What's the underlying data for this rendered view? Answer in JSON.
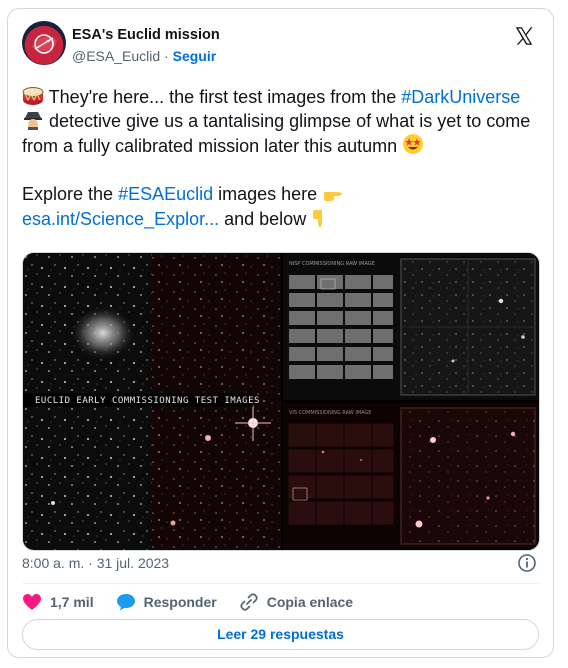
{
  "author": {
    "name": "ESA's Euclid mission",
    "handle": "@ESA_Euclid",
    "separator": "·",
    "follow_label": "Seguir"
  },
  "tweet": {
    "line1_pre": " They're here... the first test images from the",
    "hashtag_dark": "#DarkUniverse",
    "line1_post": " detective give us a tantalising glimpse of what is yet to come from a fully calibrated mission later this autumn",
    "line2_pre": "Explore the ",
    "hashtag_euclid": "#ESAEuclid",
    "line2_mid": " images here ",
    "link_text": "esa.int/Science_Explor...",
    "line2_post": " and below"
  },
  "media": {
    "left_caption": "EUCLID EARLY COMMISSIONING TEST IMAGES",
    "tr_caption": "NISP COMMISSIONING RAW IMAGE",
    "br_caption": "VIS COMMISSIONING RAW IMAGE"
  },
  "footer": {
    "timestamp": "8:00 a. m. · 31 jul. 2023",
    "likes": "1,7 mil",
    "reply_label": "Responder",
    "copy_label": "Copia enlace",
    "read_replies": "Leer 29 respuestas"
  },
  "colors": {
    "link": "#006fd6",
    "heart": "#f91880",
    "reply": "#1d9bf0",
    "muted": "#536471"
  },
  "icons": [
    "drum-icon",
    "detective-icon",
    "star-struck-icon",
    "pointing-right-icon",
    "pointing-down-icon",
    "x-logo-icon",
    "info-icon",
    "heart-icon",
    "reply-bubble-icon",
    "link-icon"
  ]
}
